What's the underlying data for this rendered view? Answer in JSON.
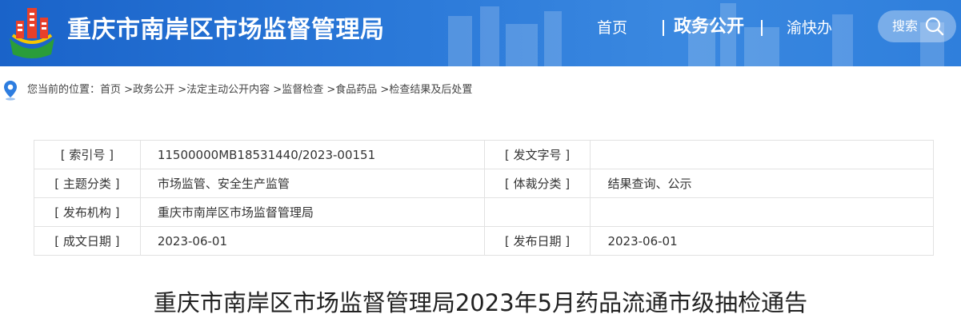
{
  "header": {
    "site_title": "重庆市南岸区市场监督管理局",
    "nav": [
      {
        "label": "首页"
      },
      {
        "label": "政务公开",
        "active": true
      },
      {
        "label": "渝快办"
      }
    ],
    "search_label": "搜索",
    "accent_color": "#1f6fd1"
  },
  "breadcrumb": {
    "prefix": "您当前的位置：",
    "items": [
      "首页",
      "政务公开",
      "法定主动公开内容",
      "监督检查",
      "食品药品",
      "检查结果及后处置"
    ],
    "separator": ">"
  },
  "meta": {
    "rows": [
      [
        {
          "k": "[ 索引号 ]",
          "v": "11500000MB18531440/2023-00151"
        },
        {
          "k": "[ 发文字号 ]",
          "v": ""
        }
      ],
      [
        {
          "k": "[ 主题分类 ]",
          "v": "市场监管、安全生产监管"
        },
        {
          "k": "[ 体裁分类 ]",
          "v": "结果查询、公示"
        }
      ],
      [
        {
          "k": "[ 发布机构 ]",
          "v": "重庆市南岸区市场监督管理局"
        },
        {
          "k": "",
          "v": ""
        }
      ],
      [
        {
          "k": "[ 成文日期 ]",
          "v": "2023-06-01"
        },
        {
          "k": "[ 发布日期 ]",
          "v": "2023-06-01"
        }
      ]
    ]
  },
  "document": {
    "title": "重庆市南岸区市场监督管理局2023年5月药品流通市级抽检通告"
  }
}
